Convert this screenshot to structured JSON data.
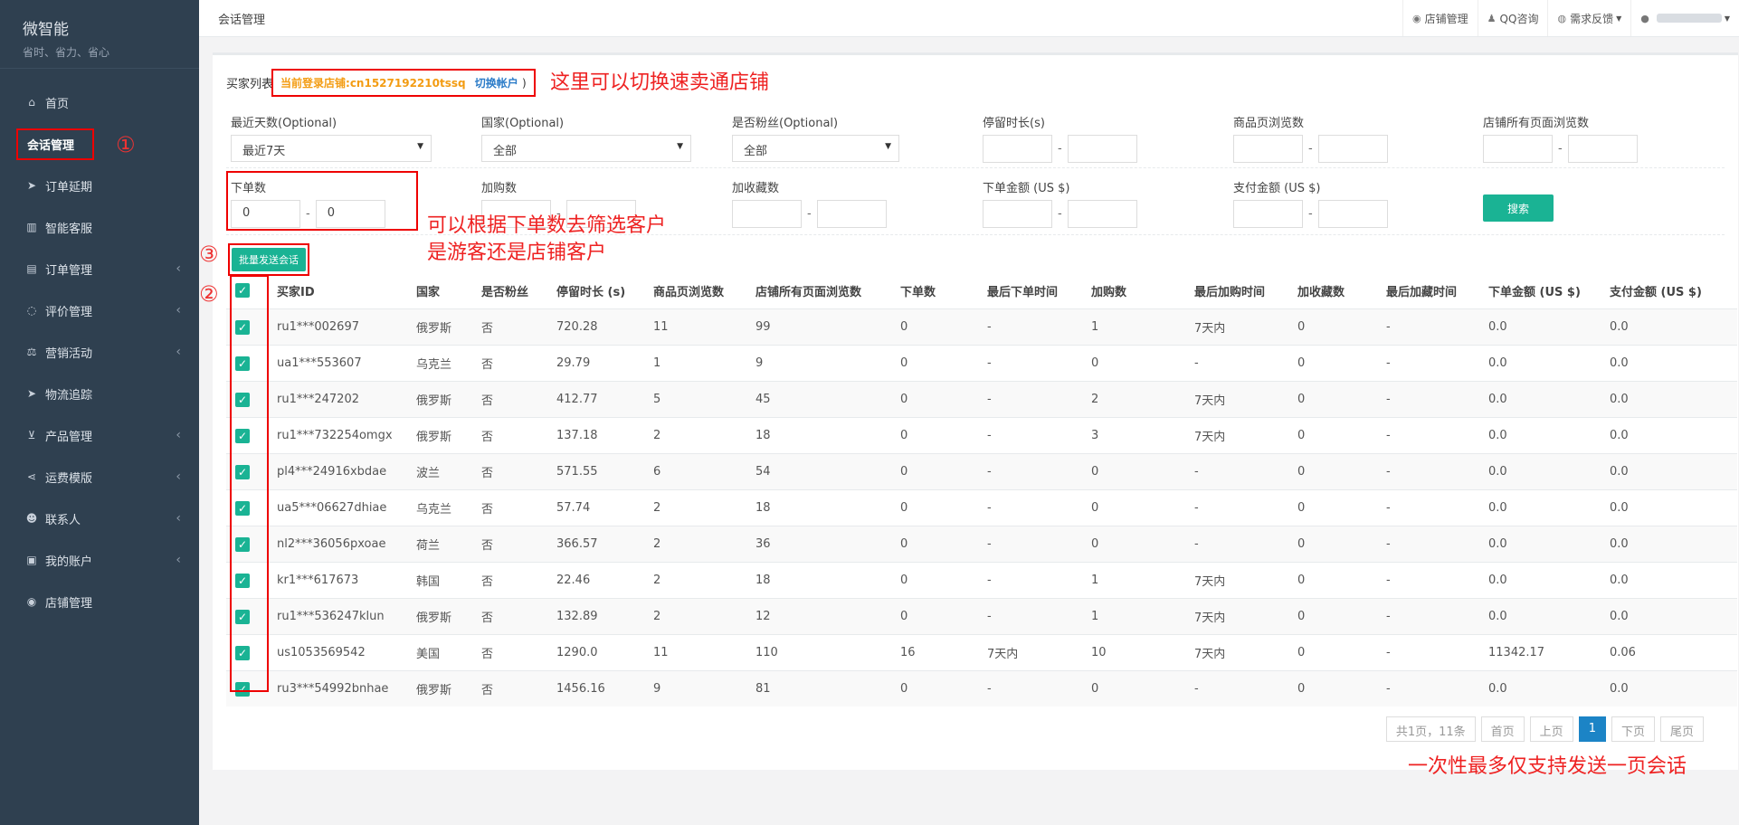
{
  "brand": {
    "name": "微智能",
    "slogan": "省时、省力、省心"
  },
  "sidebar": {
    "items": [
      {
        "label": "首页",
        "icon": "home-icon",
        "glyph": "⌂",
        "arrow": false
      },
      {
        "label": "会话管理",
        "icon": "",
        "glyph": "",
        "arrow": false
      },
      {
        "label": "订单延期",
        "icon": "paper-plane-icon",
        "glyph": "➤",
        "arrow": false
      },
      {
        "label": "智能客服",
        "icon": "bar-chart-icon",
        "glyph": "▥",
        "arrow": false
      },
      {
        "label": "订单管理",
        "icon": "file-icon",
        "glyph": "▤",
        "arrow": true
      },
      {
        "label": "评价管理",
        "icon": "comment-icon",
        "glyph": "◌",
        "arrow": true
      },
      {
        "label": "营销活动",
        "icon": "balance-icon",
        "glyph": "⚖",
        "arrow": true
      },
      {
        "label": "物流追踪",
        "icon": "paper-plane-icon",
        "glyph": "➤",
        "arrow": false
      },
      {
        "label": "产品管理",
        "icon": "cart-icon",
        "glyph": "⊻",
        "arrow": true
      },
      {
        "label": "运费模版",
        "icon": "share-icon",
        "glyph": "⋖",
        "arrow": true
      },
      {
        "label": "联系人",
        "icon": "users-icon",
        "glyph": "☻",
        "arrow": true
      },
      {
        "label": "我的账户",
        "icon": "briefcase-icon",
        "glyph": "▣",
        "arrow": true
      },
      {
        "label": "店铺管理",
        "icon": "globe-icon",
        "glyph": "◉",
        "arrow": false
      }
    ]
  },
  "topbar": {
    "title": "会话管理",
    "links": [
      "店铺管理",
      "QQ咨询",
      "需求反馈"
    ]
  },
  "header": {
    "buyer_list": "买家列表",
    "shop_login": "当前登录店铺:cn1527192210tssq",
    "switch": "切换帐户",
    "paren": ")"
  },
  "filters": {
    "days": {
      "label": "最近天数(Optional)",
      "value": "最近7天"
    },
    "country": {
      "label": "国家(Optional)",
      "value": "全部"
    },
    "fan": {
      "label": "是否粉丝(Optional)",
      "value": "全部"
    },
    "stay": {
      "label": "停留时长(s)"
    },
    "product_views": {
      "label": "商品页浏览数"
    },
    "all_views": {
      "label": "店铺所有页面浏览数"
    },
    "orders": {
      "label": "下单数",
      "min": "0",
      "max": "0"
    },
    "cart": {
      "label": "加购数"
    },
    "fav": {
      "label": "加收藏数"
    },
    "order_amount": {
      "label": "下单金额 (US $)"
    },
    "paid_amount": {
      "label": "支付金额 (US $)"
    }
  },
  "buttons": {
    "search": "搜索",
    "batch": "批量发送会话"
  },
  "table": {
    "headers": [
      "买家ID",
      "国家",
      "是否粉丝",
      "停留时长 (s)",
      "商品页浏览数",
      "店铺所有页面浏览数",
      "下单数",
      "最后下单时间",
      "加购数",
      "最后加购时间",
      "加收藏数",
      "最后加藏时间",
      "下单金额 (US $)",
      "支付金额 (US $)"
    ],
    "rows": [
      [
        "ru1***002697",
        "俄罗斯",
        "否",
        "720.28",
        "11",
        "99",
        "0",
        "-",
        "1",
        "7天内",
        "0",
        "-",
        "0.0",
        "0.0"
      ],
      [
        "ua1***553607",
        "乌克兰",
        "否",
        "29.79",
        "1",
        "9",
        "0",
        "-",
        "0",
        "-",
        "0",
        "-",
        "0.0",
        "0.0"
      ],
      [
        "ru1***247202",
        "俄罗斯",
        "否",
        "412.77",
        "5",
        "45",
        "0",
        "-",
        "2",
        "7天内",
        "0",
        "-",
        "0.0",
        "0.0"
      ],
      [
        "ru1***732254omgx",
        "俄罗斯",
        "否",
        "137.18",
        "2",
        "18",
        "0",
        "-",
        "3",
        "7天内",
        "0",
        "-",
        "0.0",
        "0.0"
      ],
      [
        "pl4***24916xbdae",
        "波兰",
        "否",
        "571.55",
        "6",
        "54",
        "0",
        "-",
        "0",
        "-",
        "0",
        "-",
        "0.0",
        "0.0"
      ],
      [
        "ua5***06627dhiae",
        "乌克兰",
        "否",
        "57.74",
        "2",
        "18",
        "0",
        "-",
        "0",
        "-",
        "0",
        "-",
        "0.0",
        "0.0"
      ],
      [
        "nl2***36056pxoae",
        "荷兰",
        "否",
        "366.57",
        "2",
        "36",
        "0",
        "-",
        "0",
        "-",
        "0",
        "-",
        "0.0",
        "0.0"
      ],
      [
        "kr1***617673",
        "韩国",
        "否",
        "22.46",
        "2",
        "18",
        "0",
        "-",
        "1",
        "7天内",
        "0",
        "-",
        "0.0",
        "0.0"
      ],
      [
        "ru1***536247klun",
        "俄罗斯",
        "否",
        "132.89",
        "2",
        "12",
        "0",
        "-",
        "1",
        "7天内",
        "0",
        "-",
        "0.0",
        "0.0"
      ],
      [
        "us1053569542",
        "美国",
        "否",
        "1290.0",
        "11",
        "110",
        "16",
        "7天内",
        "10",
        "7天内",
        "0",
        "-",
        "11342.17",
        "0.06"
      ],
      [
        "ru3***54992bnhae",
        "俄罗斯",
        "否",
        "1456.16",
        "9",
        "81",
        "0",
        "-",
        "0",
        "-",
        "0",
        "-",
        "0.0",
        "0.0"
      ]
    ]
  },
  "pager": {
    "summary": "共1页，11条",
    "first": "首页",
    "prev": "上页",
    "current": "1",
    "next": "下页",
    "last": "尾页"
  },
  "annotations": {
    "n1": "①",
    "n2": "②",
    "n3": "③",
    "switch_note": "这里可以切换速卖通店铺",
    "orders_note1": "可以根据下单数去筛选客户",
    "orders_note2": "是游客还是店铺客户",
    "page_note": "一次性最多仅支持发送一页会话"
  },
  "colors": {
    "sidebar": "#2f4050",
    "primary": "#1ab394",
    "link": "#2a7bc8",
    "shop": "#f39c12",
    "annotation": "#e00"
  }
}
